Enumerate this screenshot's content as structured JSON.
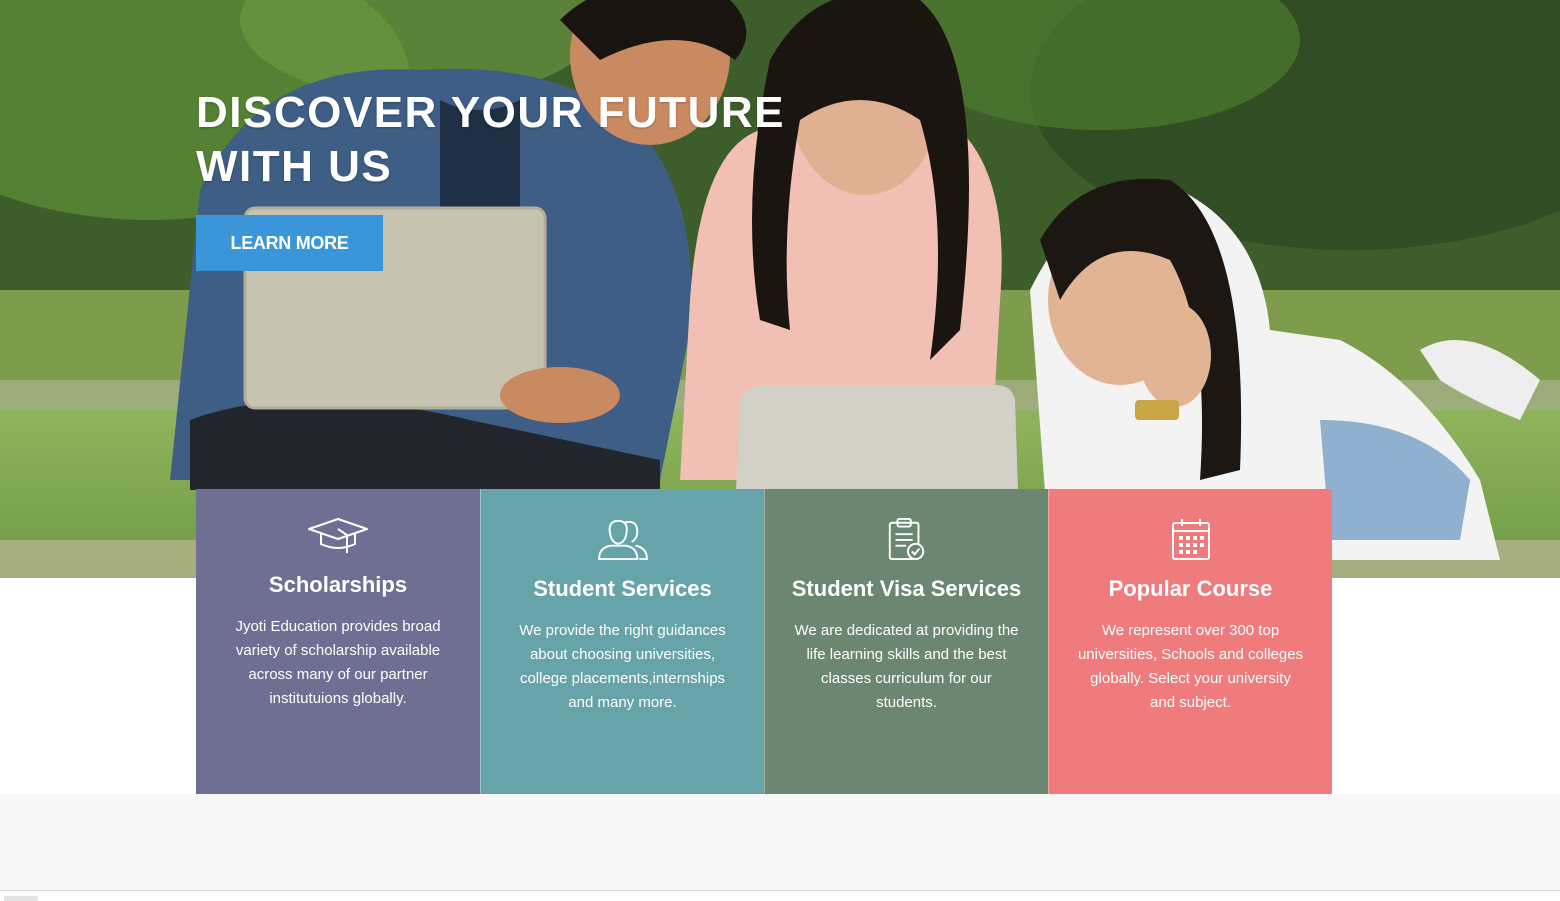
{
  "hero": {
    "title_line1": "DISCOVER YOUR FUTURE",
    "title_line2": "WITH US",
    "cta_label": "LEARN MORE",
    "cta_color": "#3a96d8"
  },
  "cards": [
    {
      "title": "Scholarships",
      "text": "Jyoti Education provides broad variety of scholarship available across many of our partner institutuions globally.",
      "icon": "graduation-cap-icon",
      "color": "#6f6f93"
    },
    {
      "title": "Student Services",
      "text": "We provide the right guidances about choosing universities, college placements,internships and many more.",
      "icon": "users-icon",
      "color": "#67a4aa"
    },
    {
      "title": "Student Visa Services",
      "text": "We are dedicated at providing the life learning skills and the best classes curriculum for our students.",
      "icon": "clipboard-check-icon",
      "color": "#6b8671"
    },
    {
      "title": "Popular Course",
      "text": "We represent over 300 top universities, Schools and colleges globally. Select your university and subject.",
      "icon": "calendar-icon",
      "color": "#f07b7d"
    }
  ]
}
